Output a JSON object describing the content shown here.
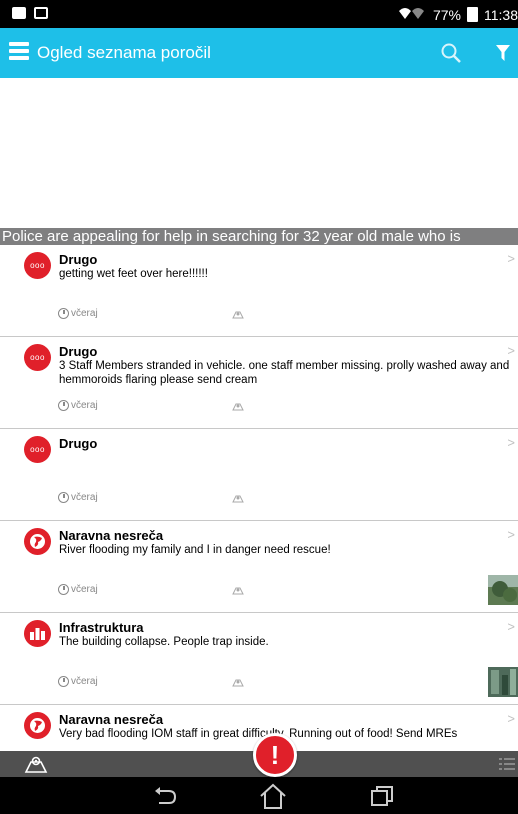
{
  "status_bar": {
    "battery": "77%",
    "time": "11:38"
  },
  "app_bar": {
    "title": "Ogled seznama poročil"
  },
  "marquee": {
    "text": "Police are appealing for help in searching for 32 year old male who is"
  },
  "reports": [
    {
      "category": "Drugo",
      "description": "getting wet feet over here!!!!!!",
      "time": "včeraj",
      "icon": "other-dots-icon",
      "has_image": false
    },
    {
      "category": "Drugo",
      "description": "3 Staff Members stranded in vehicle. one staff member missing. prolly washed away and hemmoroids flaring please send cream",
      "time": "včeraj",
      "icon": "other-dots-icon",
      "has_image": false
    },
    {
      "category": "Drugo",
      "description": "",
      "time": "včeraj",
      "icon": "other-dots-icon",
      "has_image": false
    },
    {
      "category": "Naravna nesreča",
      "description": "River flooding my family and I in danger need rescue!",
      "time": "včeraj",
      "icon": "globe-icon",
      "has_image": true
    },
    {
      "category": "Infrastruktura",
      "description": "The building collapse. People trap inside.",
      "time": "včeraj",
      "icon": "buildings-icon",
      "has_image": true
    },
    {
      "category": "Naravna nesreča",
      "description": "Very bad flooding IOM staff in great difficulty. Running out of food! Send MREs",
      "time": "",
      "icon": "globe-icon",
      "has_image": false
    }
  ],
  "alert_button": {
    "label": "!"
  },
  "colors": {
    "app_bar": "#1ebfe8",
    "category_red": "#e0202a",
    "bottom_bar": "#505050"
  }
}
